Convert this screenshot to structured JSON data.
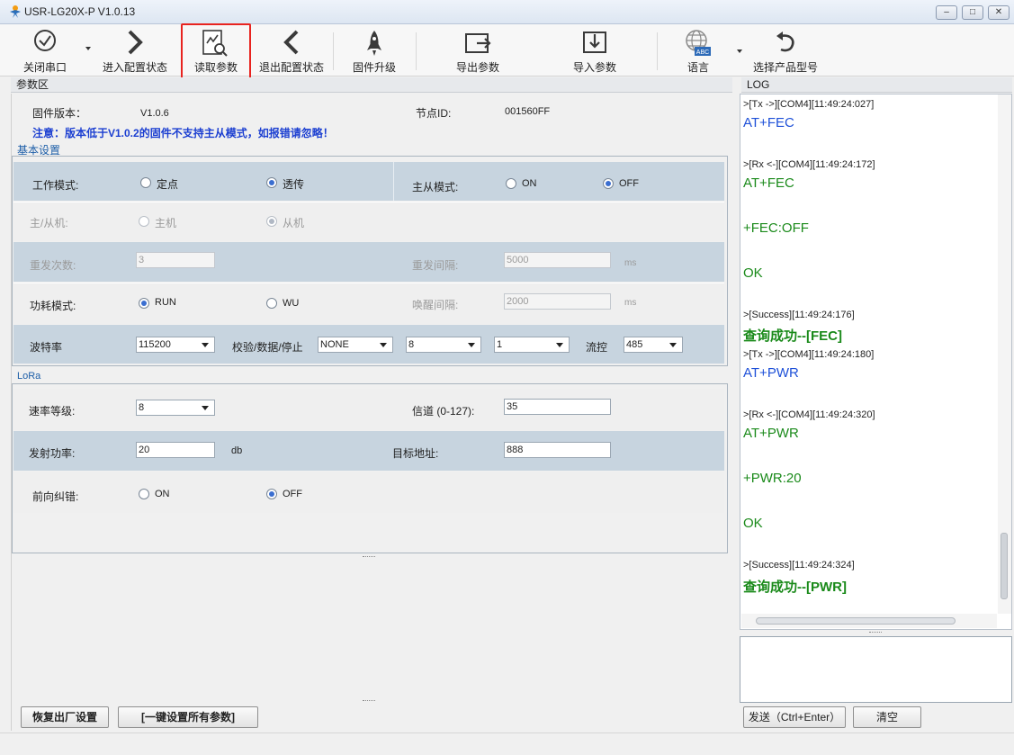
{
  "window": {
    "title": "USR-LG20X-P  V1.0.13"
  },
  "toolbar": {
    "close_port": "关闭串口",
    "enter_config": "进入配置状态",
    "read_params": "读取参数",
    "exit_config": "退出配置状态",
    "firmware_upgrade": "固件升级",
    "export_params": "导出参数",
    "import_params": "导入参数",
    "language": "语言",
    "language_icon_text": "ABC",
    "select_model": "选择产品型号"
  },
  "params": {
    "section_title": "参数区",
    "firmware_label": "固件版本：",
    "firmware_value": "V1.0.6",
    "node_id_label": "节点ID:",
    "node_id_value": "001560FF",
    "notice": "注意：版本低于V1.0.2的固件不支持主从模式，如报错请忽略！"
  },
  "basic": {
    "title": "基本设置",
    "work_mode_label": "工作模式:",
    "work_mode_fixed": "定点",
    "work_mode_transparent": "透传",
    "master_slave_mode_label": "主从模式:",
    "ms_on": "ON",
    "ms_off": "OFF",
    "master_slave_label": "主/从机:",
    "master": "主机",
    "slave": "从机",
    "retry_count_label": "重发次数:",
    "retry_count_value": "3",
    "retry_interval_label": "重发间隔:",
    "retry_interval_value": "5000",
    "ms_unit": "ms",
    "power_mode_label": "功耗模式:",
    "power_run": "RUN",
    "power_wu": "WU",
    "wake_interval_label": "唤醒间隔:",
    "wake_interval_value": "2000",
    "baud_label": "波特率",
    "baud_value": "115200",
    "parity_label": "校验/数据/停止",
    "parity_value": "NONE",
    "data_bits_value": "8",
    "stop_bits_value": "1",
    "flow_label": "流控",
    "flow_value": "485"
  },
  "lora": {
    "title": "LoRa",
    "speed_label": "速率等级:",
    "speed_value": "8",
    "channel_label": "信道 (0-127):",
    "channel_value": "35",
    "tx_power_label": "发射功率:",
    "tx_power_value": "20",
    "db_unit": "db",
    "target_addr_label": "目标地址:",
    "target_addr_value": "888",
    "fec_label": "前向纠错:",
    "fec_on": "ON",
    "fec_off": "OFF"
  },
  "buttons": {
    "factory_reset": "恢复出厂设置",
    "apply_all": "[一键设置所有参数]",
    "send": "发送（Ctrl+Enter）",
    "clear": "清空"
  },
  "log": {
    "title": "LOG",
    "lines": [
      {
        "kind": "head",
        "text": ">[Tx ->][COM4][11:49:24:027]"
      },
      {
        "kind": "tx",
        "text": "AT+FEC"
      },
      {
        "kind": "head",
        "text": ">[Rx <-][COM4][11:49:24:172]"
      },
      {
        "kind": "rx",
        "text": "AT+FEC"
      },
      {
        "kind": "rx",
        "text": "+FEC:OFF"
      },
      {
        "kind": "rx",
        "text": "OK"
      },
      {
        "kind": "head",
        "text": ">[Success][11:49:24:176]"
      },
      {
        "kind": "success",
        "text": "查询成功--[FEC]"
      },
      {
        "kind": "head",
        "text": ">[Tx ->][COM4][11:49:24:180]"
      },
      {
        "kind": "tx",
        "text": "AT+PWR"
      },
      {
        "kind": "head",
        "text": ">[Rx <-][COM4][11:49:24:320]"
      },
      {
        "kind": "rx",
        "text": "AT+PWR"
      },
      {
        "kind": "rx",
        "text": "+PWR:20"
      },
      {
        "kind": "rx",
        "text": "OK"
      },
      {
        "kind": "head",
        "text": ">[Success][11:49:24:324]"
      },
      {
        "kind": "success",
        "text": "查询成功--[PWR]"
      }
    ]
  }
}
